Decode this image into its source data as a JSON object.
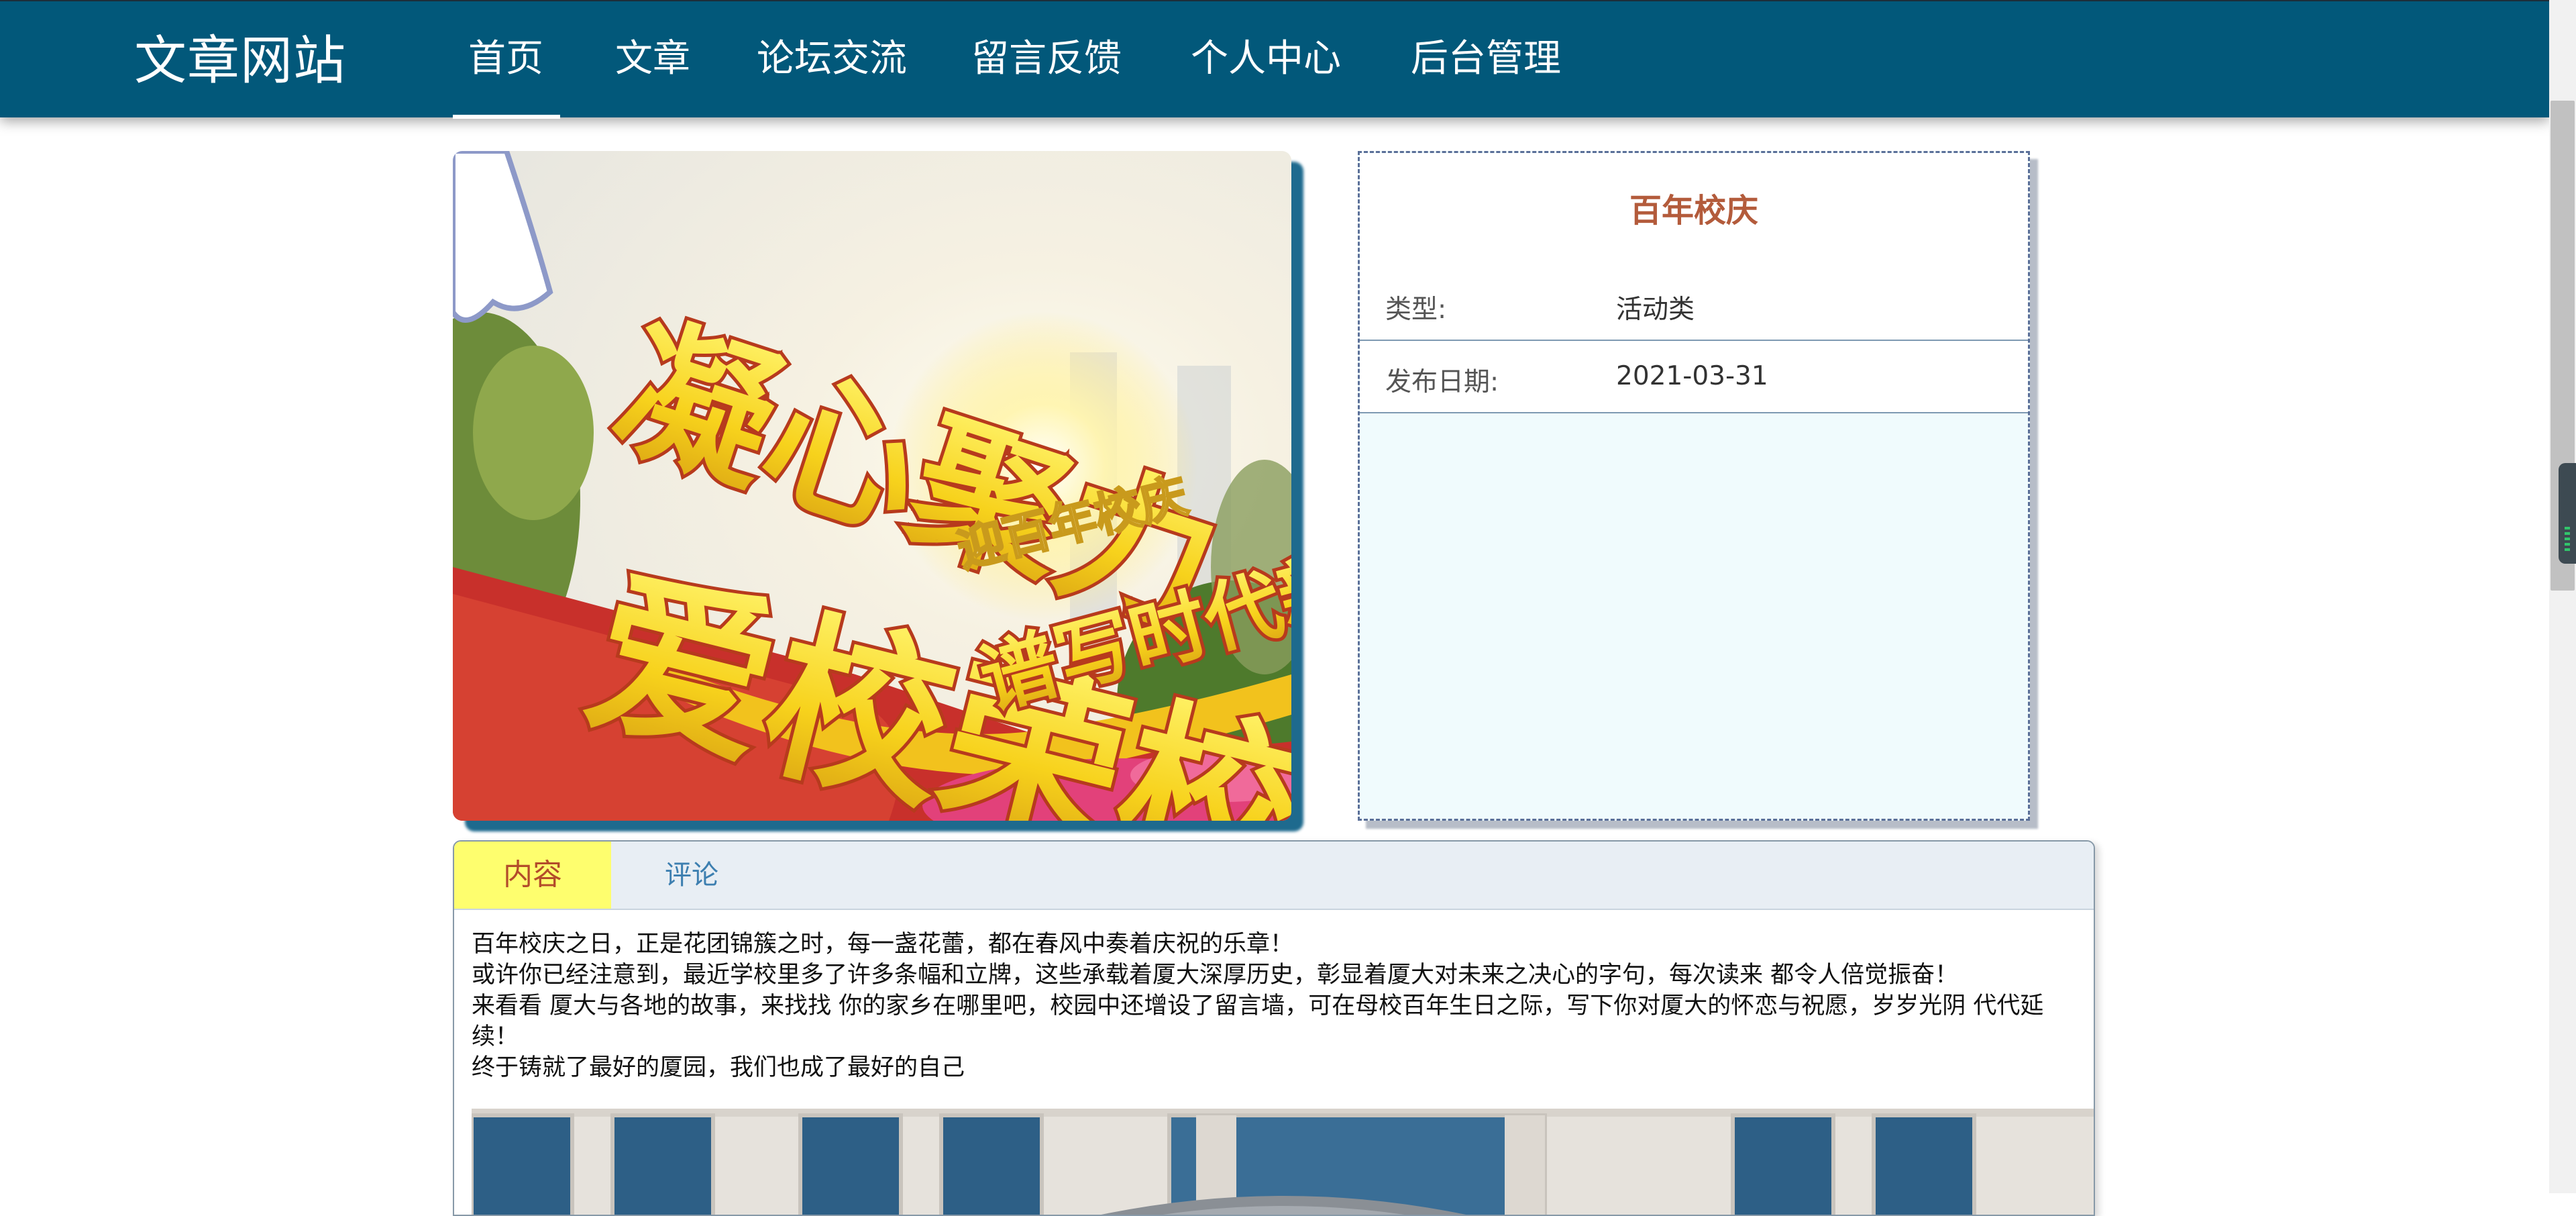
{
  "site": {
    "brand": "文章网站"
  },
  "nav": {
    "items": [
      {
        "label": "首页",
        "active": true
      },
      {
        "label": "文章"
      },
      {
        "label": "论坛交流"
      },
      {
        "label": "留言反馈"
      },
      {
        "label": "个人中心"
      },
      {
        "label": "后台管理"
      }
    ]
  },
  "article": {
    "title": "百年校庆",
    "type_label": "类型:",
    "type_value": "活动类",
    "date_label": "发布日期:",
    "date_value": "2021-03-31",
    "hero_text": "凝心聚力 爱校荣校 谱写时代新篇",
    "hero_caption_small": "迎百年校庆"
  },
  "tabs": {
    "content": "内容",
    "comments": "评论"
  },
  "content": {
    "paragraphs": [
      "百年校庆之日，正是花团锦簇之时，每一盏花蕾，都在春风中奏着庆祝的乐章！",
      "或许你已经注意到，最近学校里多了许多条幅和立牌，这些承载着厦大深厚历史，彰显着厦大对未来之决心的字句，每次读来 都令人倍觉振奋！",
      "来看看 厦大与各地的故事，来找找 你的家乡在哪里吧，校园中还增设了留言墙，可在母校百年生日之际，写下你对厦大的怀恋与祝愿，岁岁光阴 代代延续！",
      "终于铸就了最好的厦园，我们也成了最好的自己"
    ]
  },
  "colors": {
    "header": "#02587a",
    "title_accent": "#b35b3b",
    "tab_active_bg": "#fefe6e",
    "tab_link": "#3d7fb0"
  }
}
